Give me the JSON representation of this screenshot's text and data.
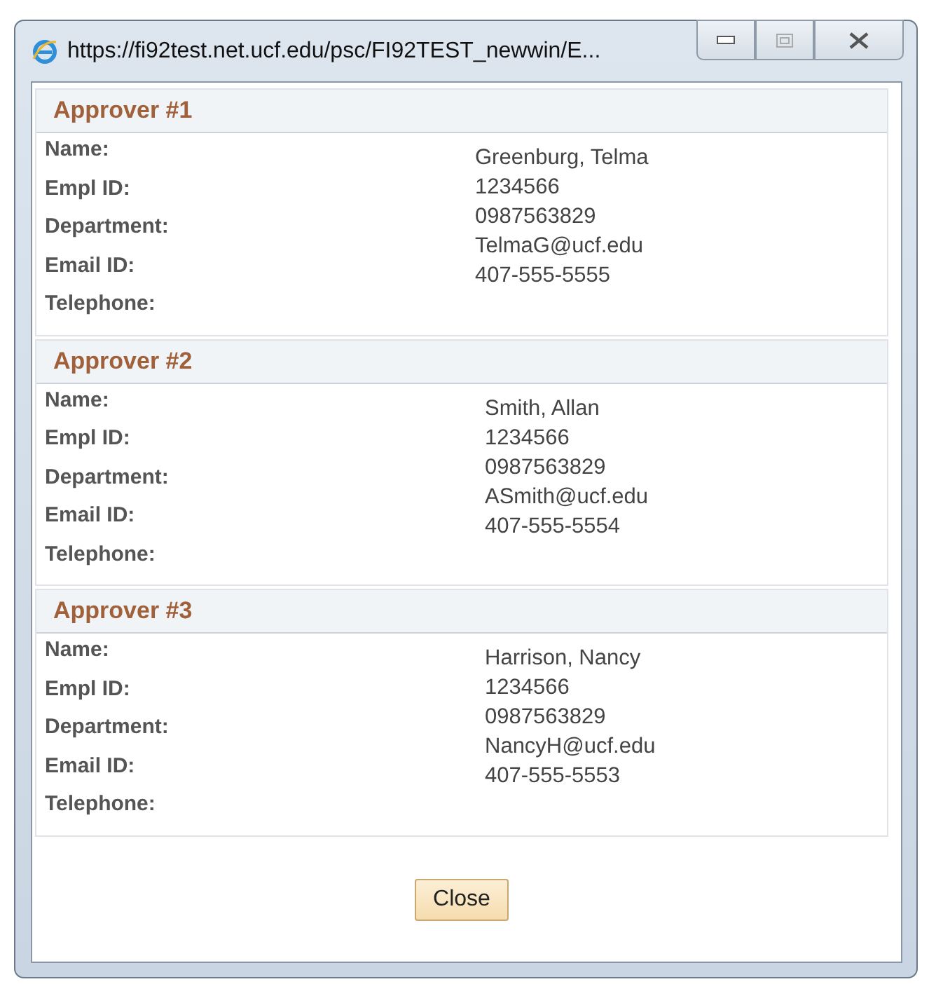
{
  "window": {
    "title": "https://fi92test.net.ucf.edu/psc/FI92TEST_newwin/E..."
  },
  "approvers": [
    {
      "heading": "Approver #1",
      "labels": [
        "Name:",
        "Empl ID:",
        "Department:",
        "Email ID:",
        "Telephone:"
      ],
      "values": [
        "Greenburg, Telma",
        "1234566",
        "0987563829",
        "TelmaG@ucf.edu",
        "407-555-5555"
      ]
    },
    {
      "heading": "Approver #2",
      "labels": [
        "Name:",
        "Empl ID:",
        "Department:",
        "Email ID:",
        "Telephone:"
      ],
      "values": [
        "Smith, Allan",
        "1234566",
        "0987563829",
        "ASmith@ucf.edu",
        "407-555-5554"
      ]
    },
    {
      "heading": "Approver #3",
      "labels": [
        "Name:",
        "Empl ID:",
        "Department:",
        "Email ID:",
        "Telephone:"
      ],
      "values": [
        "Harrison, Nancy",
        "1234566",
        "0987563829",
        "NancyH@ucf.edu",
        "407-555-5553"
      ]
    }
  ],
  "buttons": [
    "Close"
  ]
}
